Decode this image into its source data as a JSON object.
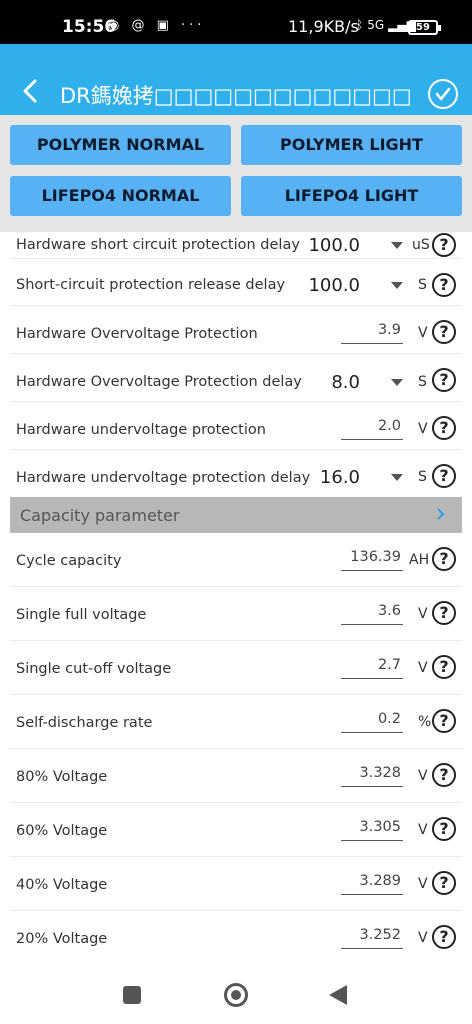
{
  "status_bar": {
    "time": "15:56",
    "left_icons": "◉ @ ▣ ···",
    "speed": "11,9KB/s",
    "network": "5G",
    "battery": "59"
  },
  "header": {
    "title": "DR鎷婏拷□□□□□□□□□□□□□□□□□□搵!C婁",
    "accent_color": "#2fb0ec"
  },
  "presets": {
    "polymer_normal": "POLYMER NORMAL",
    "polymer_light": "POLYMER LIGHT",
    "lifepo4_normal": "LIFEPO4 NORMAL",
    "lifepo4_light": "LIFEPO4 LIGHT",
    "button_color": "#58b1f3"
  },
  "protection": {
    "short_circuit_delay": {
      "label": "Hardware short circuit protection delay",
      "value": "100.0",
      "unit": "uS"
    },
    "short_circuit_release_delay": {
      "label": "Short-circuit protection release delay",
      "value": "100.0",
      "unit": "S"
    },
    "overvoltage": {
      "label": "Hardware Overvoltage Protection",
      "value": "3.9",
      "unit": "V"
    },
    "overvoltage_delay": {
      "label": "Hardware Overvoltage Protection delay",
      "value": "8.0",
      "unit": "S"
    },
    "undervoltage": {
      "label": "Hardware undervoltage protection",
      "value": "2.0",
      "unit": "V"
    },
    "undervoltage_delay": {
      "label": "Hardware undervoltage protection delay",
      "value": "16.0",
      "unit": "S"
    }
  },
  "capacity_section": {
    "title": "Capacity parameter",
    "cycle_capacity": {
      "label": "Cycle capacity",
      "value": "136.39",
      "unit": "AH"
    },
    "single_full_voltage": {
      "label": "Single full voltage",
      "value": "3.6",
      "unit": "V"
    },
    "single_cutoff_voltage": {
      "label": "Single cut-off voltage",
      "value": "2.7",
      "unit": "V"
    },
    "self_discharge_rate": {
      "label": "Self-discharge rate",
      "value": "0.2",
      "unit": "%"
    },
    "v80": {
      "label": "80% Voltage",
      "value": "3.328",
      "unit": "V"
    },
    "v60": {
      "label": "60% Voltage",
      "value": "3.305",
      "unit": "V"
    },
    "v40": {
      "label": "40% Voltage",
      "value": "3.289",
      "unit": "V"
    },
    "v20": {
      "label": "20% Voltage",
      "value": "3.252",
      "unit": "V"
    }
  },
  "help_glyph": "?"
}
